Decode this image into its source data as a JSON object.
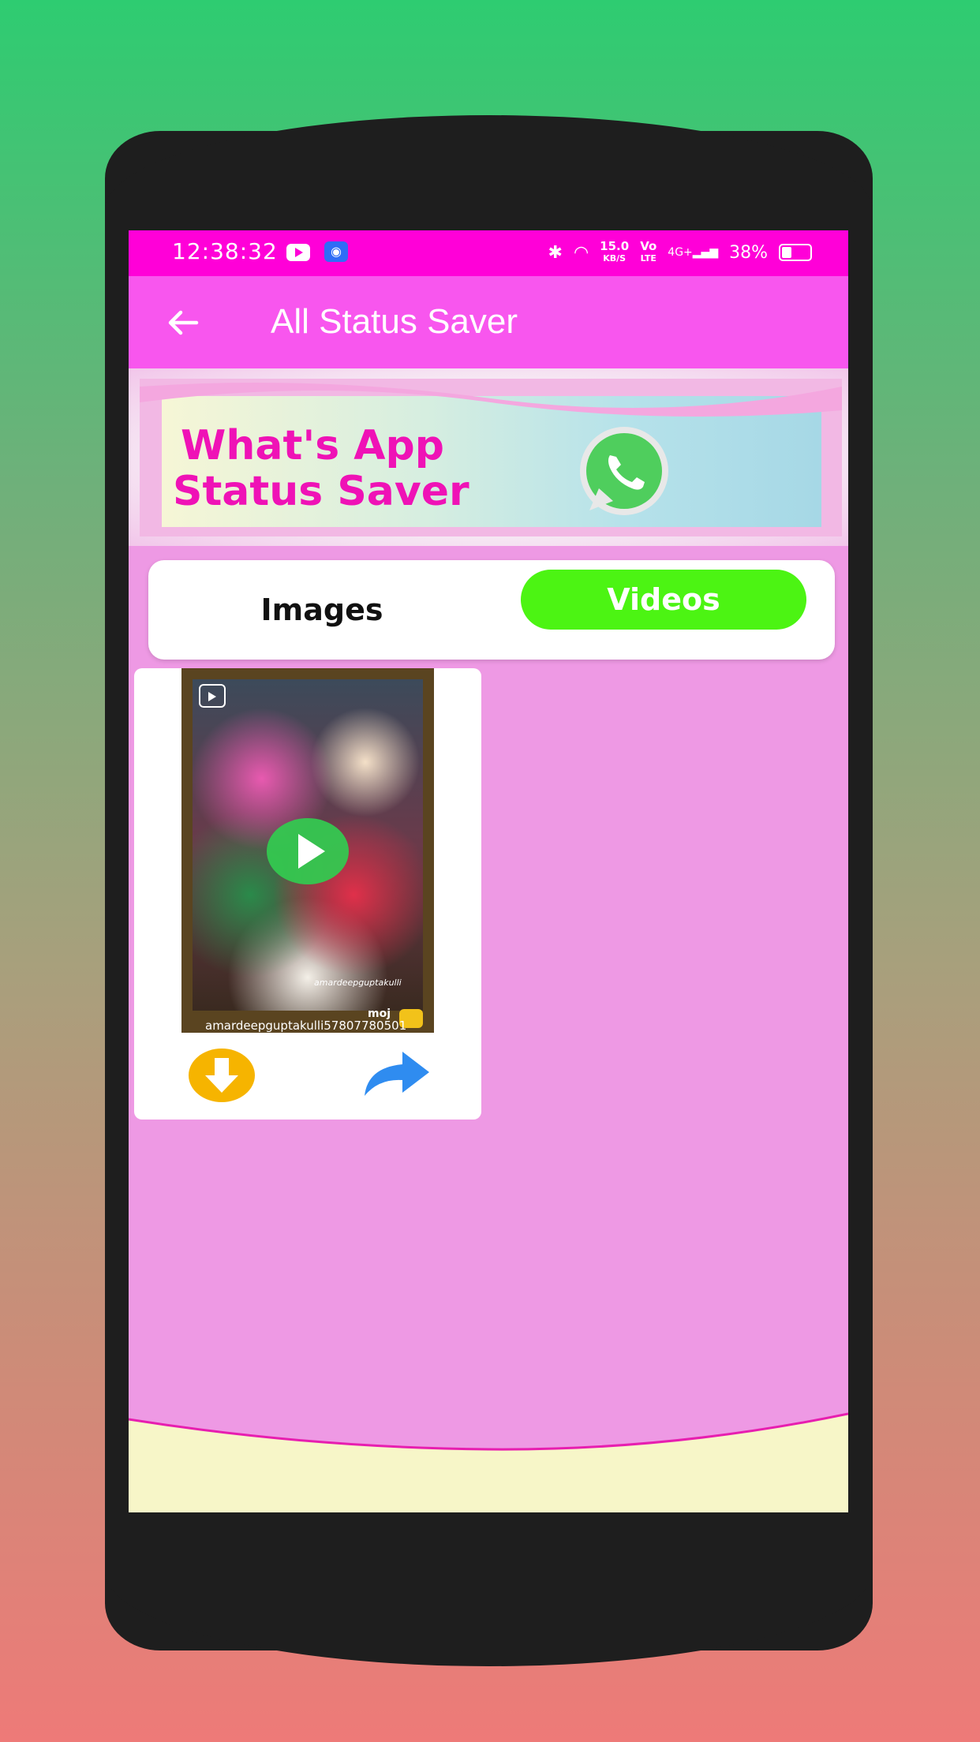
{
  "status_bar": {
    "time": "12:38:32",
    "speed_value": "15.0",
    "speed_unit": "KB/S",
    "volte_top": "Vo",
    "volte_bottom": "LTE",
    "network": "4G+",
    "battery": "38%"
  },
  "app_bar": {
    "title": "All Status Saver"
  },
  "banner": {
    "line1": "What's App",
    "line2": "Status Saver"
  },
  "tabs": {
    "images_label": "Images",
    "videos_label": "Videos",
    "selected": "Videos"
  },
  "video_card": {
    "watermark_top": "amardeepguptakulli",
    "watermark_bottom": "amardeepguptakulli57807780501",
    "brand": "moj"
  },
  "colors": {
    "status_bar": "#ff00d8",
    "app_bar": "#f856ee",
    "selected_tab": "#4cf413",
    "screen_bg": "#ee99e4",
    "banner_text": "#ef12b6"
  },
  "icons": [
    "back-arrow-icon",
    "youtube-icon",
    "android-bot-icon",
    "bluetooth-icon",
    "headphones-icon",
    "signal-icon",
    "battery-icon",
    "whatsapp-icon",
    "reels-icon",
    "play-icon",
    "download-icon",
    "share-icon"
  ]
}
